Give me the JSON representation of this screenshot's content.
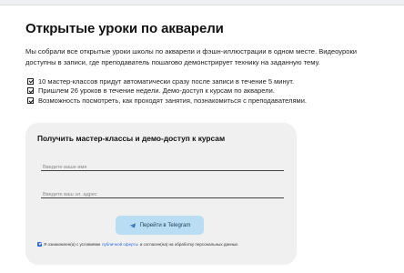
{
  "page": {
    "title": "Открытые уроки по акварели",
    "intro": "Мы собрали все открытые уроки школы по акварели и фэшн-иллюстрации в одном месте. Видеоуроки доступны в записи, где преподаватель пошагово демонстрирует технику на заданную тему."
  },
  "benefits": [
    "10 мастер-классов придут автоматически сразу после записи в течение 5 минут.",
    "Пришлем 26 уроков в течение недели. Демо-доступ к курсам по акварели.",
    "Возможность посмотреть, как проходят занятия, познакомиться с преподавателями."
  ],
  "form": {
    "title": "Получить мастер-классы и демо-доступ к курсам",
    "name_placeholder": "Введите ваше имя",
    "email_placeholder": "Введите ваш эл. адрес",
    "submit_label": "Перейти в Telegram",
    "submit_icon": "telegram-icon",
    "consent_prefix": "Я ознакомлен(а) с условиями",
    "consent_link": "публичной оферты",
    "consent_suffix": "и согласен(на) на обработку персональных данных",
    "consent_checked": true
  },
  "colors": {
    "accent": "#2d6cdf",
    "button_bg": "#b9ddf3",
    "card_bg": "#f0f0f1"
  }
}
